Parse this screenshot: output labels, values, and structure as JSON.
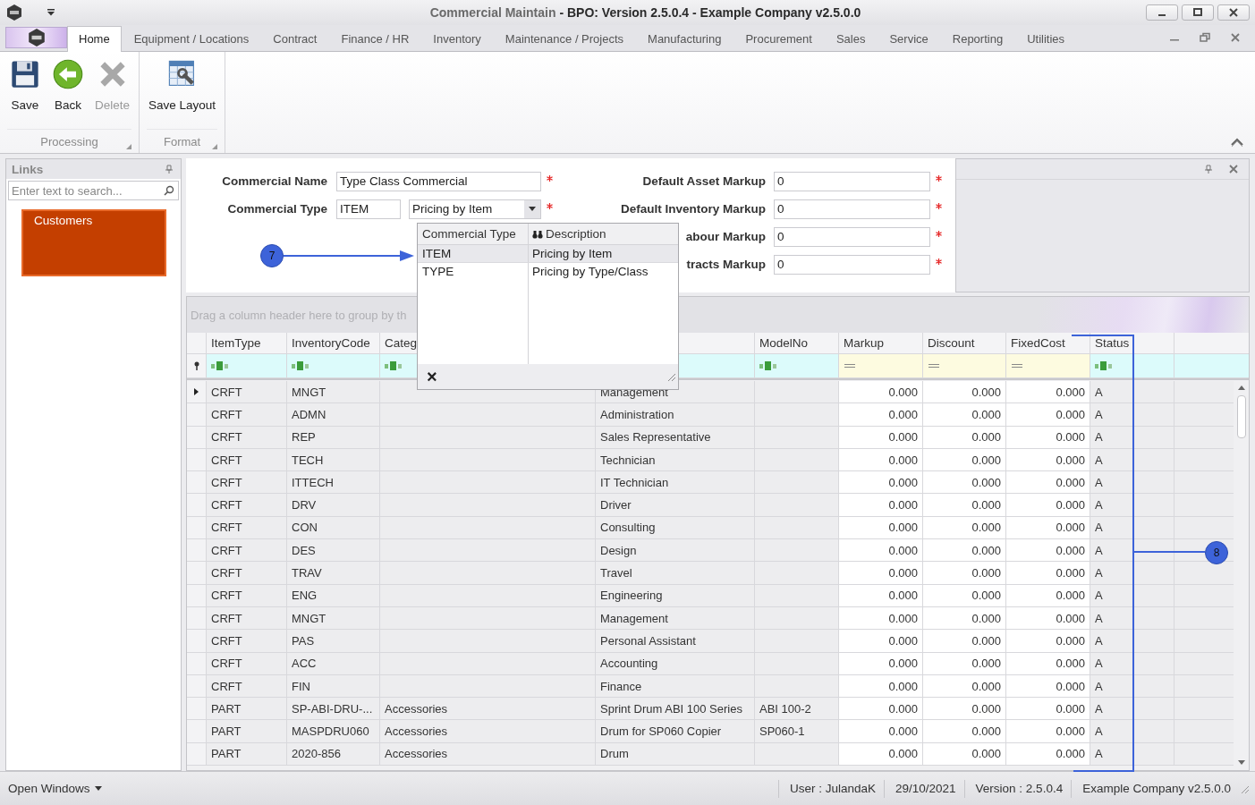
{
  "window": {
    "module": "Commercial Maintain",
    "product": "- BPO: Version 2.5.0.4 - Example Company v2.5.0.0"
  },
  "tabs": [
    {
      "label": "Home",
      "selected": true
    },
    {
      "label": "Equipment / Locations",
      "selected": false
    },
    {
      "label": "Contract",
      "selected": false
    },
    {
      "label": "Finance / HR",
      "selected": false
    },
    {
      "label": "Inventory",
      "selected": false
    },
    {
      "label": "Maintenance / Projects",
      "selected": false
    },
    {
      "label": "Manufacturing",
      "selected": false
    },
    {
      "label": "Procurement",
      "selected": false
    },
    {
      "label": "Sales",
      "selected": false
    },
    {
      "label": "Service",
      "selected": false
    },
    {
      "label": "Reporting",
      "selected": false
    },
    {
      "label": "Utilities",
      "selected": false
    }
  ],
  "ribbon": [
    {
      "label": "Processing",
      "buttons": [
        {
          "label": "Save",
          "kind": "save",
          "disabled": false
        },
        {
          "label": "Back",
          "kind": "back",
          "disabled": false
        },
        {
          "label": "Delete",
          "kind": "delete",
          "disabled": true
        }
      ]
    },
    {
      "label": "Format",
      "buttons": [
        {
          "label": "Save Layout",
          "kind": "layout",
          "disabled": false
        }
      ]
    }
  ],
  "links": {
    "title": "Links",
    "placeholder": "Enter text to search...",
    "items": [
      "Customers"
    ]
  },
  "form": {
    "left": [
      {
        "label": "Commercial Name",
        "value": "Type Class Commercial",
        "required": true
      },
      {
        "label": "Commercial Type",
        "code": "ITEM",
        "value": "Pricing by Item",
        "required": true
      }
    ],
    "right": [
      {
        "label": "Default Asset Markup",
        "value": "0",
        "required": true
      },
      {
        "label": "Default Inventory Markup",
        "value": "0",
        "required": true
      },
      {
        "label": "abour Markup",
        "value": "0",
        "required": true
      },
      {
        "label": "tracts Markup",
        "value": "0",
        "required": true
      }
    ]
  },
  "dropdown": {
    "columns": [
      "Commercial Type",
      "Description"
    ],
    "rows": [
      {
        "code": "ITEM",
        "description": "Pricing by Item",
        "selected": true
      },
      {
        "code": "TYPE",
        "description": "Pricing by Type/Class",
        "selected": false
      }
    ],
    "close": "×"
  },
  "grid": {
    "group_hint": "Drag a column header here to group by th",
    "columns": [
      {
        "label": "ItemType",
        "kind": "text"
      },
      {
        "label": "InventoryCode",
        "kind": "text"
      },
      {
        "label": "Categ",
        "kind": "text"
      },
      {
        "kind": "text"
      },
      {
        "label": "ModelNo",
        "kind": "text"
      },
      {
        "label": "Markup",
        "kind": "number"
      },
      {
        "label": "Discount",
        "kind": "number"
      },
      {
        "label": "FixedCost",
        "kind": "number"
      },
      {
        "label": "Status",
        "kind": "text"
      }
    ],
    "rows": [
      {
        "selected": true,
        "item_type": "CRFT",
        "inventory_code": "MNGT",
        "description": "Management",
        "markup": "0.000",
        "discount": "0.000",
        "fixed_cost": "0.000",
        "status": "A"
      },
      {
        "selected": false,
        "item_type": "CRFT",
        "inventory_code": "ADMN",
        "description": "Administration",
        "markup": "0.000",
        "discount": "0.000",
        "fixed_cost": "0.000",
        "status": "A"
      },
      {
        "selected": false,
        "item_type": "CRFT",
        "inventory_code": "REP",
        "description": "Sales Representative",
        "markup": "0.000",
        "discount": "0.000",
        "fixed_cost": "0.000",
        "status": "A"
      },
      {
        "selected": false,
        "item_type": "CRFT",
        "inventory_code": "TECH",
        "description": "Technician",
        "markup": "0.000",
        "discount": "0.000",
        "fixed_cost": "0.000",
        "status": "A"
      },
      {
        "selected": false,
        "item_type": "CRFT",
        "inventory_code": "ITTECH",
        "description": "IT Technician",
        "markup": "0.000",
        "discount": "0.000",
        "fixed_cost": "0.000",
        "status": "A"
      },
      {
        "selected": false,
        "item_type": "CRFT",
        "inventory_code": "DRV",
        "description": "Driver",
        "markup": "0.000",
        "discount": "0.000",
        "fixed_cost": "0.000",
        "status": "A"
      },
      {
        "selected": false,
        "item_type": "CRFT",
        "inventory_code": "CON",
        "description": "Consulting",
        "markup": "0.000",
        "discount": "0.000",
        "fixed_cost": "0.000",
        "status": "A"
      },
      {
        "selected": false,
        "item_type": "CRFT",
        "inventory_code": "DES",
        "description": "Design",
        "markup": "0.000",
        "discount": "0.000",
        "fixed_cost": "0.000",
        "status": "A"
      },
      {
        "selected": false,
        "item_type": "CRFT",
        "inventory_code": "TRAV",
        "description": "Travel",
        "markup": "0.000",
        "discount": "0.000",
        "fixed_cost": "0.000",
        "status": "A"
      },
      {
        "selected": false,
        "item_type": "CRFT",
        "inventory_code": "ENG",
        "description": "Engineering",
        "markup": "0.000",
        "discount": "0.000",
        "fixed_cost": "0.000",
        "status": "A"
      },
      {
        "selected": false,
        "item_type": "CRFT",
        "inventory_code": "MNGT",
        "description": "Management",
        "markup": "0.000",
        "discount": "0.000",
        "fixed_cost": "0.000",
        "status": "A"
      },
      {
        "selected": false,
        "item_type": "CRFT",
        "inventory_code": "PAS",
        "description": "Personal Assistant",
        "markup": "0.000",
        "discount": "0.000",
        "fixed_cost": "0.000",
        "status": "A"
      },
      {
        "selected": false,
        "item_type": "CRFT",
        "inventory_code": "ACC",
        "description": "Accounting",
        "markup": "0.000",
        "discount": "0.000",
        "fixed_cost": "0.000",
        "status": "A"
      },
      {
        "selected": false,
        "item_type": "CRFT",
        "inventory_code": "FIN",
        "description": "Finance",
        "markup": "0.000",
        "discount": "0.000",
        "fixed_cost": "0.000",
        "status": "A"
      },
      {
        "selected": false,
        "item_type": "PART",
        "inventory_code": "SP-ABI-DRU-...",
        "category": "Accessories",
        "description": "Sprint Drum ABI 100 Series",
        "model_no": "ABI 100-2",
        "markup": "0.000",
        "discount": "0.000",
        "fixed_cost": "0.000",
        "status": "A"
      },
      {
        "selected": false,
        "item_type": "PART",
        "inventory_code": "MASPDRU060",
        "category": "Accessories",
        "description": "Drum for SP060 Copier",
        "model_no": "SP060-1",
        "markup": "0.000",
        "discount": "0.000",
        "fixed_cost": "0.000",
        "status": "A"
      },
      {
        "selected": false,
        "item_type": "PART",
        "inventory_code": "2020-856",
        "category": "Accessories",
        "description": "Drum",
        "markup": "0.000",
        "discount": "0.000",
        "fixed_cost": "0.000",
        "status": "A"
      }
    ]
  },
  "callouts": [
    "7",
    "8"
  ],
  "status_bar": {
    "menu": "Open Windows",
    "items": [
      "User : JulandaK",
      "29/10/2021",
      "Version : 2.5.0.4",
      "Example Company v2.5.0.0"
    ]
  }
}
